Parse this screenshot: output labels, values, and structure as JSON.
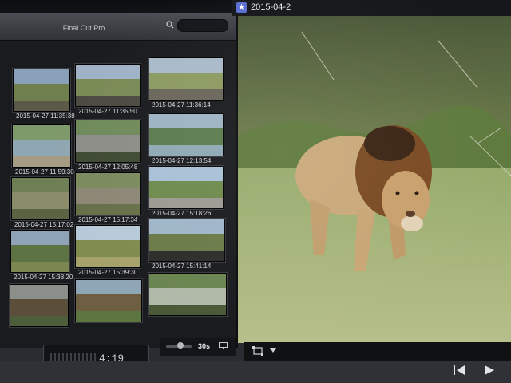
{
  "app": {
    "title": "Final Cut Pro"
  },
  "viewer": {
    "clip_date": "2015-04-2"
  },
  "browser": {
    "clips": [
      {
        "timestamp": "2015-04-27 11:35:38",
        "scene": "elephants-bush"
      },
      {
        "timestamp": "2015-04-27 11:35:50",
        "scene": "elephants-road"
      },
      {
        "timestamp": "2015-04-27 11:36:14",
        "scene": "elephants-grass"
      },
      {
        "timestamp": "2015-04-27 11:59:30",
        "scene": "river"
      },
      {
        "timestamp": "2015-04-27 12:05:48",
        "scene": "road-car"
      },
      {
        "timestamp": "2015-04-27 12:13:54",
        "scene": "lake"
      },
      {
        "timestamp": "2015-04-27 15:17:02",
        "scene": "bush"
      },
      {
        "timestamp": "2015-04-27 15:17:34",
        "scene": "rhino"
      },
      {
        "timestamp": "2015-04-27 15:18:26",
        "scene": "road-sky"
      },
      {
        "timestamp": "2015-04-27 15:38:20",
        "scene": "trees"
      },
      {
        "timestamp": "2015-04-27 15:39:30",
        "scene": "savanna"
      },
      {
        "timestamp": "2015-04-27 15:41:14",
        "scene": "buffalo-road"
      },
      {
        "timestamp": "",
        "scene": "lodge"
      },
      {
        "timestamp": "",
        "scene": "huts"
      },
      {
        "timestamp": "",
        "scene": "branches"
      }
    ],
    "duration_label": "30s"
  },
  "timecode": {
    "value": "4:19"
  },
  "icons": {
    "search": "search-icon",
    "star": "star-icon",
    "transform": "transform-icon",
    "caret": "chevron-down-icon",
    "prev": "skip-back-icon",
    "play": "play-icon",
    "filmstrip": "filmstrip-icon"
  },
  "colors": {
    "accent": "#5a6fd0",
    "panel": "#1a1b1e",
    "text": "#d8d9de"
  }
}
